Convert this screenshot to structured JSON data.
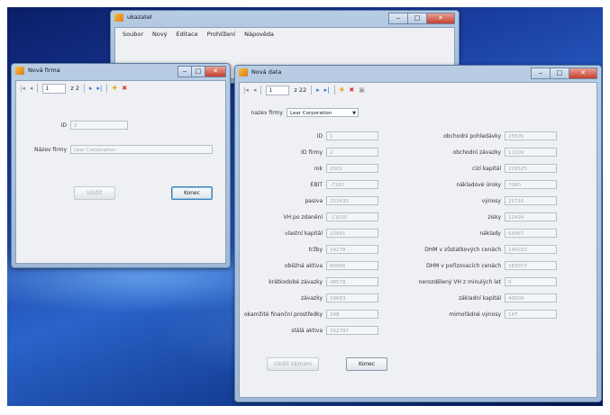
{
  "main_window": {
    "title": "ukazatel",
    "menu": [
      "Soubor",
      "Nový",
      "Editace",
      "Prohlížení",
      "Nápověda"
    ]
  },
  "firma_window": {
    "title": "Nová firma",
    "nav": {
      "prev_first": "|◂",
      "prev": "◂",
      "position": "1",
      "count": "z 2"
    },
    "id_label": "ID",
    "id_value": "2",
    "name_label": "Název firmy",
    "name_value": "Lear Corporation",
    "ulozit": "Uložit",
    "konec": "Konec"
  },
  "data_window": {
    "title": "Nová data",
    "nav": {
      "position": "1",
      "count": "z 22"
    },
    "company_label": "nazev firmy",
    "company_value": "Lear Corporation",
    "left_fields": [
      {
        "label": "ID",
        "value": "1"
      },
      {
        "label": "ID firmy",
        "value": "2"
      },
      {
        "label": "rok",
        "value": "2001"
      },
      {
        "label": "EBIT",
        "value": "-7182"
      },
      {
        "label": "pasiva",
        "value": "252435"
      },
      {
        "label": "VH po zdanění",
        "value": "-11020"
      },
      {
        "label": "vlastní kapitál",
        "value": "22891"
      },
      {
        "label": "tržby",
        "value": "24278"
      },
      {
        "label": "oběžná aktiva",
        "value": "90066"
      },
      {
        "label": "krátkodobé závazky",
        "value": "48578"
      },
      {
        "label": "závazky",
        "value": "18683"
      },
      {
        "label": "okamžité finanční prostředky",
        "value": "248"
      },
      {
        "label": "stálá aktiva",
        "value": "162797"
      }
    ],
    "right_fields": [
      {
        "label": "obchodní pohledávky",
        "value": "25505"
      },
      {
        "label": "obchodní závazky",
        "value": "11009"
      },
      {
        "label": "cizí kapitál",
        "value": "229525"
      },
      {
        "label": "nákladové úroky",
        "value": "7060"
      },
      {
        "label": "výnosy",
        "value": "25716"
      },
      {
        "label": "zisky",
        "value": "12494"
      },
      {
        "label": "náklady",
        "value": "65967"
      },
      {
        "label": "DHM v zůstatkových cenách",
        "value": "140032"
      },
      {
        "label": "DHM v pořizovacích cenách",
        "value": "183077"
      },
      {
        "label": "nerozdělený VH z minulých let",
        "value": "0"
      },
      {
        "label": "základní kapitál",
        "value": "40000"
      },
      {
        "label": "mimořádné výnosy",
        "value": "147"
      }
    ],
    "ulozit": "Uložit záznam",
    "konec": "Konec"
  }
}
